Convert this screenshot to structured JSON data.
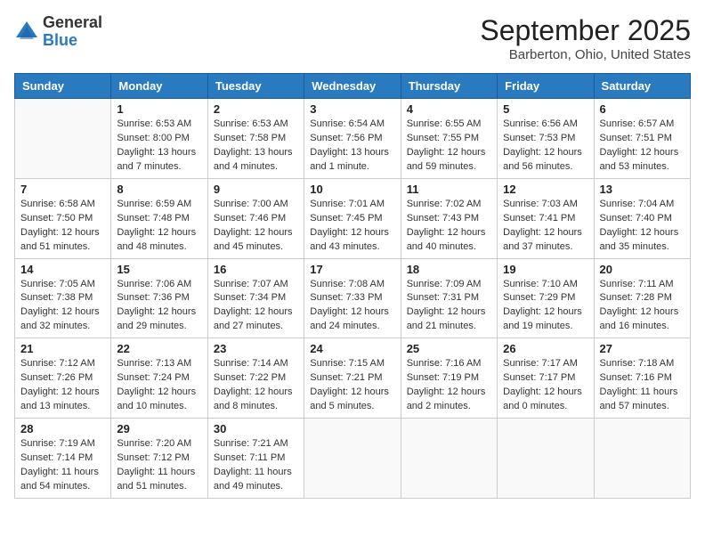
{
  "header": {
    "logo_general": "General",
    "logo_blue": "Blue",
    "month_title": "September 2025",
    "location": "Barberton, Ohio, United States"
  },
  "weekdays": [
    "Sunday",
    "Monday",
    "Tuesday",
    "Wednesday",
    "Thursday",
    "Friday",
    "Saturday"
  ],
  "weeks": [
    [
      {
        "day": null
      },
      {
        "day": "1",
        "sunrise": "Sunrise: 6:53 AM",
        "sunset": "Sunset: 8:00 PM",
        "daylight": "Daylight: 13 hours and 7 minutes."
      },
      {
        "day": "2",
        "sunrise": "Sunrise: 6:53 AM",
        "sunset": "Sunset: 7:58 PM",
        "daylight": "Daylight: 13 hours and 4 minutes."
      },
      {
        "day": "3",
        "sunrise": "Sunrise: 6:54 AM",
        "sunset": "Sunset: 7:56 PM",
        "daylight": "Daylight: 13 hours and 1 minute."
      },
      {
        "day": "4",
        "sunrise": "Sunrise: 6:55 AM",
        "sunset": "Sunset: 7:55 PM",
        "daylight": "Daylight: 12 hours and 59 minutes."
      },
      {
        "day": "5",
        "sunrise": "Sunrise: 6:56 AM",
        "sunset": "Sunset: 7:53 PM",
        "daylight": "Daylight: 12 hours and 56 minutes."
      },
      {
        "day": "6",
        "sunrise": "Sunrise: 6:57 AM",
        "sunset": "Sunset: 7:51 PM",
        "daylight": "Daylight: 12 hours and 53 minutes."
      }
    ],
    [
      {
        "day": "7",
        "sunrise": "Sunrise: 6:58 AM",
        "sunset": "Sunset: 7:50 PM",
        "daylight": "Daylight: 12 hours and 51 minutes."
      },
      {
        "day": "8",
        "sunrise": "Sunrise: 6:59 AM",
        "sunset": "Sunset: 7:48 PM",
        "daylight": "Daylight: 12 hours and 48 minutes."
      },
      {
        "day": "9",
        "sunrise": "Sunrise: 7:00 AM",
        "sunset": "Sunset: 7:46 PM",
        "daylight": "Daylight: 12 hours and 45 minutes."
      },
      {
        "day": "10",
        "sunrise": "Sunrise: 7:01 AM",
        "sunset": "Sunset: 7:45 PM",
        "daylight": "Daylight: 12 hours and 43 minutes."
      },
      {
        "day": "11",
        "sunrise": "Sunrise: 7:02 AM",
        "sunset": "Sunset: 7:43 PM",
        "daylight": "Daylight: 12 hours and 40 minutes."
      },
      {
        "day": "12",
        "sunrise": "Sunrise: 7:03 AM",
        "sunset": "Sunset: 7:41 PM",
        "daylight": "Daylight: 12 hours and 37 minutes."
      },
      {
        "day": "13",
        "sunrise": "Sunrise: 7:04 AM",
        "sunset": "Sunset: 7:40 PM",
        "daylight": "Daylight: 12 hours and 35 minutes."
      }
    ],
    [
      {
        "day": "14",
        "sunrise": "Sunrise: 7:05 AM",
        "sunset": "Sunset: 7:38 PM",
        "daylight": "Daylight: 12 hours and 32 minutes."
      },
      {
        "day": "15",
        "sunrise": "Sunrise: 7:06 AM",
        "sunset": "Sunset: 7:36 PM",
        "daylight": "Daylight: 12 hours and 29 minutes."
      },
      {
        "day": "16",
        "sunrise": "Sunrise: 7:07 AM",
        "sunset": "Sunset: 7:34 PM",
        "daylight": "Daylight: 12 hours and 27 minutes."
      },
      {
        "day": "17",
        "sunrise": "Sunrise: 7:08 AM",
        "sunset": "Sunset: 7:33 PM",
        "daylight": "Daylight: 12 hours and 24 minutes."
      },
      {
        "day": "18",
        "sunrise": "Sunrise: 7:09 AM",
        "sunset": "Sunset: 7:31 PM",
        "daylight": "Daylight: 12 hours and 21 minutes."
      },
      {
        "day": "19",
        "sunrise": "Sunrise: 7:10 AM",
        "sunset": "Sunset: 7:29 PM",
        "daylight": "Daylight: 12 hours and 19 minutes."
      },
      {
        "day": "20",
        "sunrise": "Sunrise: 7:11 AM",
        "sunset": "Sunset: 7:28 PM",
        "daylight": "Daylight: 12 hours and 16 minutes."
      }
    ],
    [
      {
        "day": "21",
        "sunrise": "Sunrise: 7:12 AM",
        "sunset": "Sunset: 7:26 PM",
        "daylight": "Daylight: 12 hours and 13 minutes."
      },
      {
        "day": "22",
        "sunrise": "Sunrise: 7:13 AM",
        "sunset": "Sunset: 7:24 PM",
        "daylight": "Daylight: 12 hours and 10 minutes."
      },
      {
        "day": "23",
        "sunrise": "Sunrise: 7:14 AM",
        "sunset": "Sunset: 7:22 PM",
        "daylight": "Daylight: 12 hours and 8 minutes."
      },
      {
        "day": "24",
        "sunrise": "Sunrise: 7:15 AM",
        "sunset": "Sunset: 7:21 PM",
        "daylight": "Daylight: 12 hours and 5 minutes."
      },
      {
        "day": "25",
        "sunrise": "Sunrise: 7:16 AM",
        "sunset": "Sunset: 7:19 PM",
        "daylight": "Daylight: 12 hours and 2 minutes."
      },
      {
        "day": "26",
        "sunrise": "Sunrise: 7:17 AM",
        "sunset": "Sunset: 7:17 PM",
        "daylight": "Daylight: 12 hours and 0 minutes."
      },
      {
        "day": "27",
        "sunrise": "Sunrise: 7:18 AM",
        "sunset": "Sunset: 7:16 PM",
        "daylight": "Daylight: 11 hours and 57 minutes."
      }
    ],
    [
      {
        "day": "28",
        "sunrise": "Sunrise: 7:19 AM",
        "sunset": "Sunset: 7:14 PM",
        "daylight": "Daylight: 11 hours and 54 minutes."
      },
      {
        "day": "29",
        "sunrise": "Sunrise: 7:20 AM",
        "sunset": "Sunset: 7:12 PM",
        "daylight": "Daylight: 11 hours and 51 minutes."
      },
      {
        "day": "30",
        "sunrise": "Sunrise: 7:21 AM",
        "sunset": "Sunset: 7:11 PM",
        "daylight": "Daylight: 11 hours and 49 minutes."
      },
      {
        "day": null
      },
      {
        "day": null
      },
      {
        "day": null
      },
      {
        "day": null
      }
    ]
  ]
}
